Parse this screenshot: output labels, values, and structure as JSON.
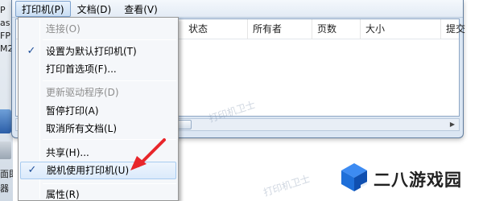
{
  "desktop": {
    "fragments": [
      "P",
      "as",
      "FP",
      "M2",
      "面即",
      "器"
    ]
  },
  "menubar": {
    "items": [
      "打印机(P)",
      "文档(D)",
      "查看(V)"
    ]
  },
  "columns": [
    "状态",
    "所有者",
    "页数",
    "大小",
    "提交"
  ],
  "dropdown": {
    "items": [
      {
        "label": "连接(O)",
        "checked": false,
        "disabled": true
      },
      {
        "label": "设置为默认打印机(T)",
        "checked": true,
        "disabled": false
      },
      {
        "label": "打印首选项(F)...",
        "checked": false,
        "disabled": false
      },
      {
        "label": "更新驱动程序(D)",
        "checked": false,
        "disabled": true
      },
      {
        "label": "暂停打印(A)",
        "checked": false,
        "disabled": false
      },
      {
        "label": "取消所有文档(L)",
        "checked": false,
        "disabled": false
      },
      {
        "label": "共享(H)...",
        "checked": false,
        "disabled": false
      },
      {
        "label": "脱机使用打印机(U)",
        "checked": true,
        "disabled": false
      },
      {
        "label": "属性(R)",
        "checked": false,
        "disabled": false
      }
    ]
  },
  "watermark": "打印机卫士",
  "logo": {
    "text": "二八游戏园"
  },
  "colors": {
    "accent": "#1f4f9a",
    "annotation_arrow": "#e8262b",
    "logo_blue": "#1e6fd9"
  }
}
